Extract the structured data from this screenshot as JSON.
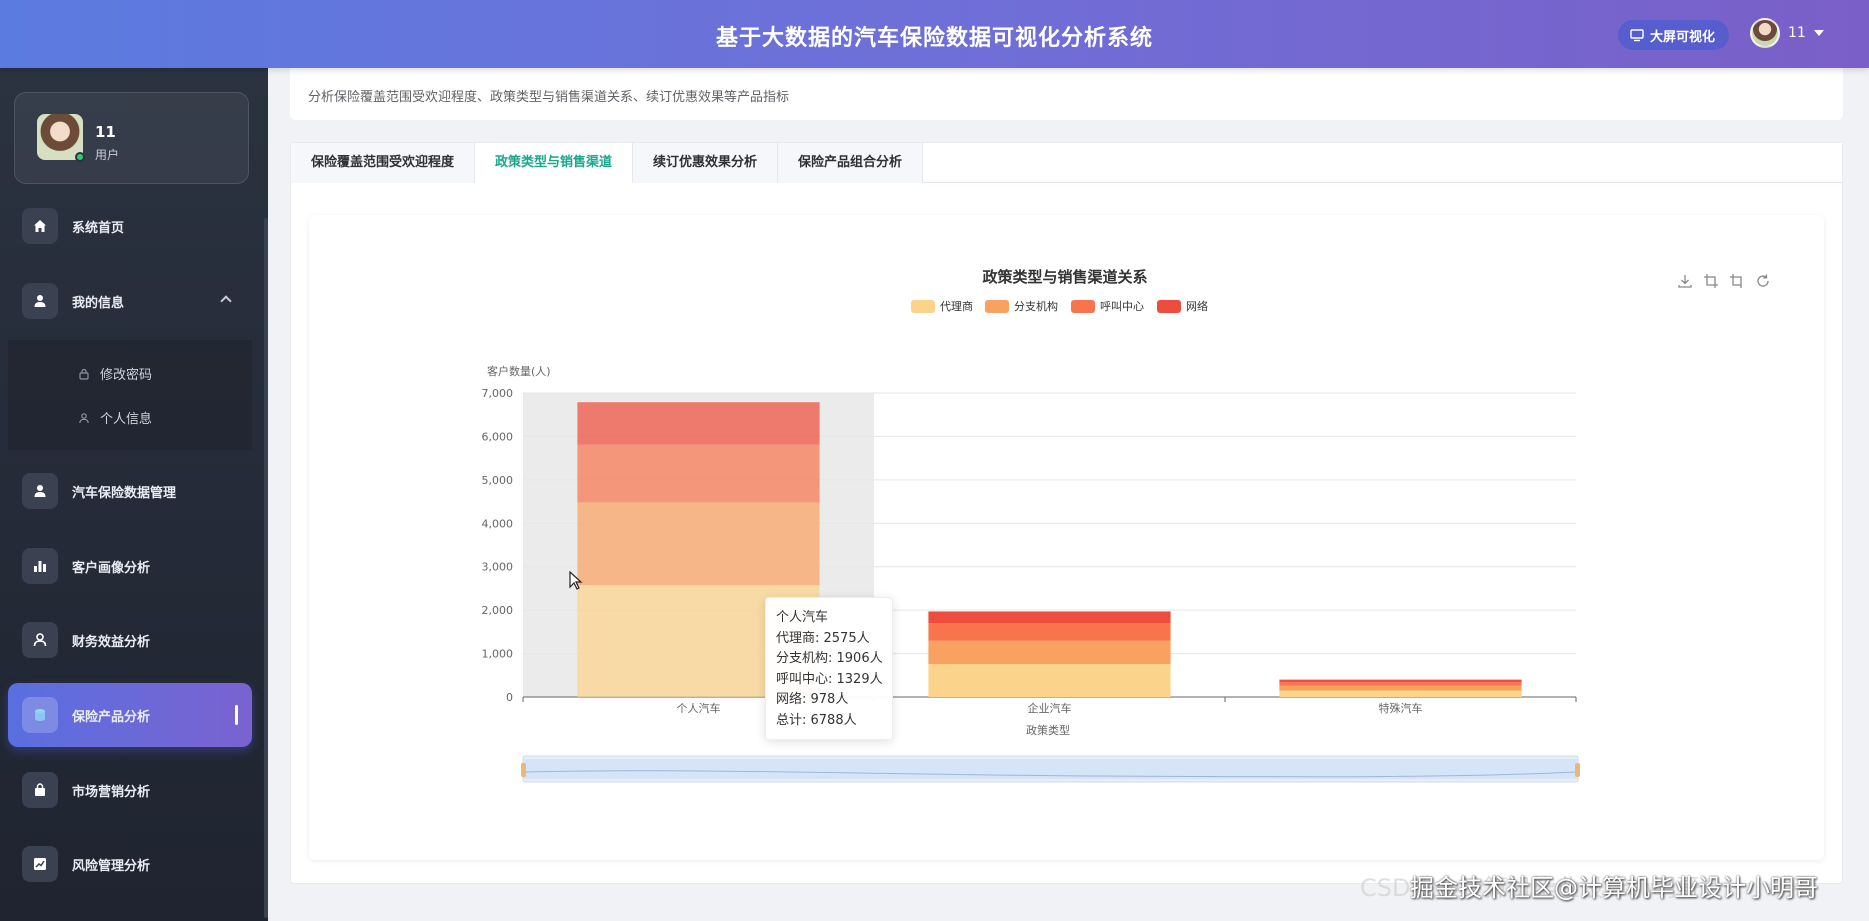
{
  "header": {
    "title": "基于大数据的汽车保险数据可视化分析系统",
    "bigscreen_label": "大屏可视化",
    "username": "11"
  },
  "sidebar": {
    "user": {
      "name": "11",
      "role": "用户"
    },
    "items": [
      {
        "label": "系统首页",
        "icon": "home-icon"
      },
      {
        "label": "我的信息",
        "icon": "user-icon"
      },
      {
        "label": "汽车保险数据管理",
        "icon": "user-icon"
      },
      {
        "label": "客户画像分析",
        "icon": "bar-chart-icon"
      },
      {
        "label": "财务效益分析",
        "icon": "user-icon"
      },
      {
        "label": "保险产品分析",
        "icon": "database-icon"
      },
      {
        "label": "市场营销分析",
        "icon": "bag-icon"
      },
      {
        "label": "风险管理分析",
        "icon": "trend-icon"
      }
    ],
    "sub_items": [
      {
        "label": "修改密码",
        "icon": "lock-icon"
      },
      {
        "label": "个人信息",
        "icon": "person-icon"
      }
    ]
  },
  "page": {
    "description": "分析保险覆盖范围受欢迎程度、政策类型与销售渠道关系、续订优惠效果等产品指标",
    "tabs": [
      "保险覆盖范围受欢迎程度",
      "政策类型与销售渠道",
      "续订优惠效果分析",
      "保险产品组合分析"
    ],
    "active_tab": 1
  },
  "tooltip": {
    "title": "个人汽车",
    "lines": [
      "代理商: 2575人",
      "分支机构: 1906人",
      "呼叫中心: 1329人",
      "网络: 978人",
      "总计: 6788人"
    ]
  },
  "watermark": {
    "back": "CSDN @计算机毕业设计小明哥",
    "front": "掘金技术社区@计算机毕业设计小明哥"
  },
  "chart_data": {
    "type": "bar",
    "stacked": true,
    "title": "政策类型与销售渠道关系",
    "xlabel": "政策类型",
    "ylabel": "客户数量(人)",
    "ylim": [
      0,
      7000
    ],
    "yticks": [
      "0",
      "1,000",
      "2,000",
      "3,000",
      "4,000",
      "5,000",
      "6,000",
      "7,000"
    ],
    "categories": [
      "个人汽车",
      "企业汽车",
      "特殊汽车"
    ],
    "series": [
      {
        "name": "代理商",
        "values": [
          2575,
          760,
          150
        ],
        "color": "#fcd38b"
      },
      {
        "name": "分支机构",
        "values": [
          1906,
          540,
          110
        ],
        "color": "#f9a160"
      },
      {
        "name": "呼叫中心",
        "values": [
          1329,
          400,
          80
        ],
        "color": "#f7744d"
      },
      {
        "name": "网络",
        "values": [
          978,
          270,
          60
        ],
        "color": "#ee4c3c"
      }
    ],
    "legend_position": "top-center",
    "highlighted_category": "个人汽车",
    "grid": true
  }
}
